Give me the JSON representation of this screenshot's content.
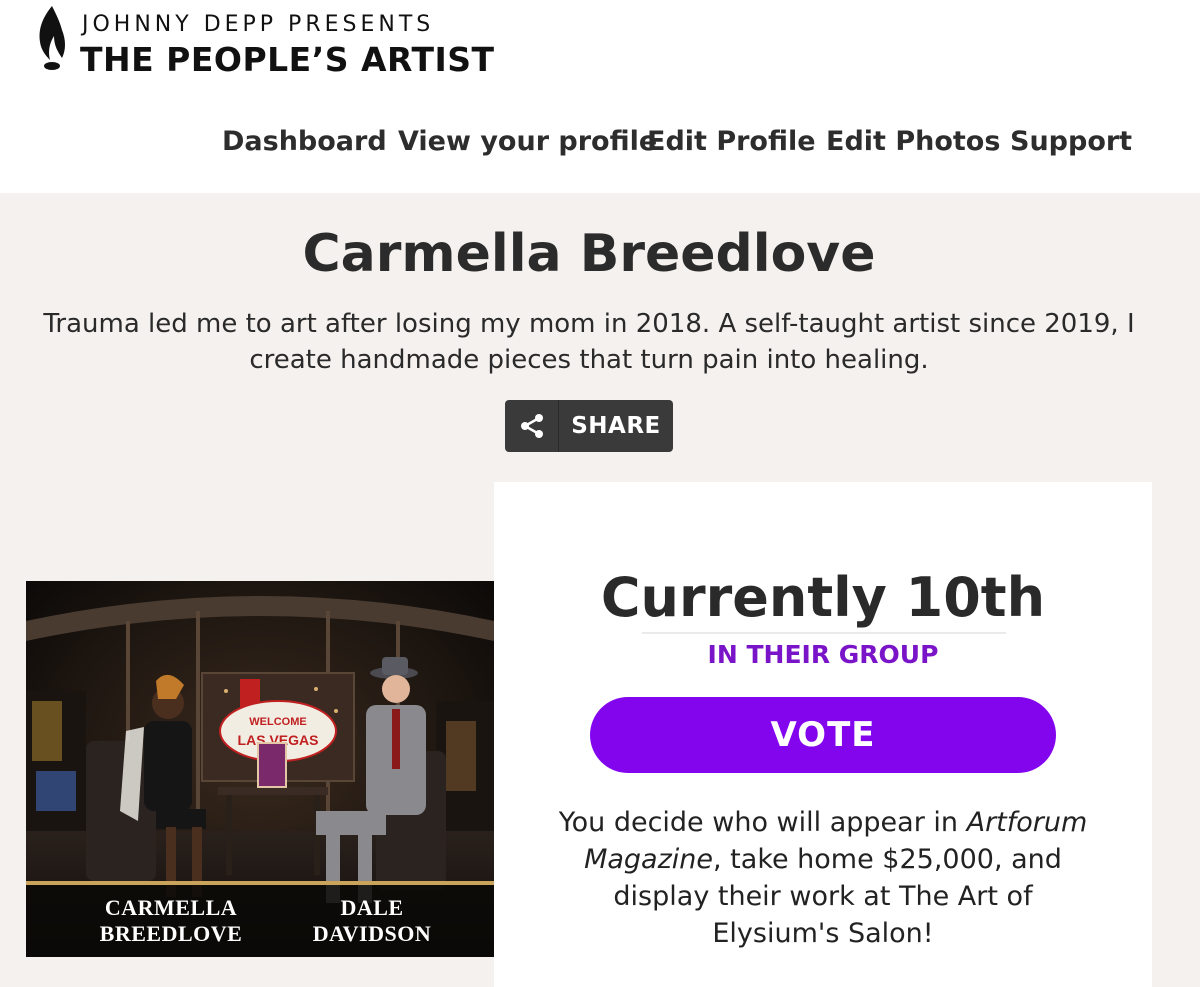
{
  "brand": {
    "presenter": "JOHNNY DEPP PRESENTS",
    "title": "THE PEOPLE’S ARTIST"
  },
  "nav": {
    "items": [
      {
        "label": "Dashboard"
      },
      {
        "label": "View your profile"
      },
      {
        "label": "Edit Profile"
      },
      {
        "label": "Edit Photos"
      },
      {
        "label": "Support"
      }
    ]
  },
  "profile": {
    "name": "Carmella Breedlove",
    "bio": "Trauma led me to art after losing my mom in 2018. A self-taught artist since 2019, I create handmade pieces that turn pain into healing.",
    "share_label": "SHARE"
  },
  "video": {
    "caption_left_line1": "CARMELLA",
    "caption_left_line2": "BREEDLOVE",
    "caption_right_line1": "DALE",
    "caption_right_line2": "DAVIDSON",
    "sign_line1": "WELCOME",
    "sign_line2": "LAS VEGAS"
  },
  "vote": {
    "rank": "Currently 10th",
    "group_label": "IN THEIR GROUP",
    "button_label": "VOTE",
    "desc_part1": "You decide who will appear in",
    "desc_magazine": "Artforum Magazine",
    "desc_part2": ", take home $25,000, and display their work at The Art of Elysium's Salon!"
  },
  "colors": {
    "accent_purple": "#8205ee",
    "group_purple": "#7a14c8",
    "page_bg": "#f4f1ee",
    "share_bg": "#3a3a3a"
  },
  "icons": {
    "logo": "flame-icon",
    "share": "share-icon"
  }
}
